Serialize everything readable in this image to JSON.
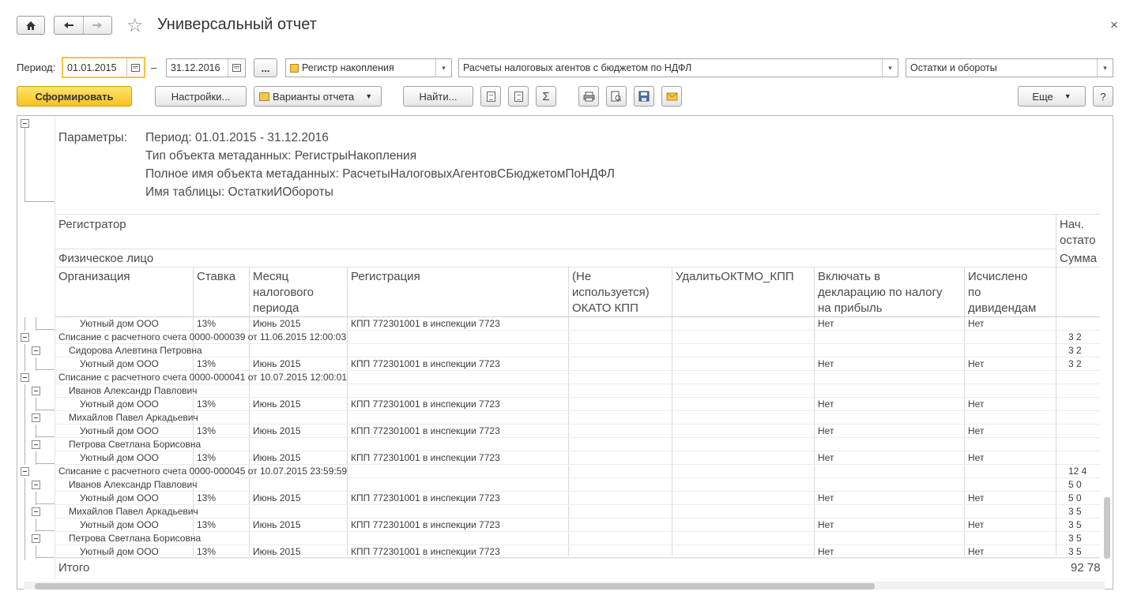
{
  "window": {
    "title": "Универсальный отчет",
    "home_icon": "home-icon",
    "back_icon": "arrow-left-icon",
    "forward_icon": "arrow-right-icon",
    "favorite_icon": "star-icon",
    "close_label": "×"
  },
  "period": {
    "label": "Период:",
    "from": "01.01.2015",
    "dash": "–",
    "to": "31.12.2016",
    "choose_label": "...",
    "source_type": "Регистр накопления",
    "source_object": "Расчеты налоговых агентов с бюджетом по НДФЛ",
    "source_table": "Остатки и обороты"
  },
  "toolbar": {
    "generate": "Сформировать",
    "settings": "Настройки...",
    "variants": "Варианты отчета",
    "find": "Найти...",
    "sum_symbol": "Σ",
    "more": "Еще",
    "help": "?"
  },
  "params": {
    "label": "Параметры:",
    "lines": [
      "Период: 01.01.2015 - 31.12.2016",
      "Тип объекта метаданных: РегистрыНакопления",
      "Полное имя объекта метаданных: РасчетыНалоговыхАгентовСБюджетомПоНДФЛ",
      "Имя таблицы: ОстаткиИОбороты"
    ]
  },
  "headers": {
    "registrar": "Регистратор",
    "person": "Физическое лицо",
    "org": "Организация",
    "rate": "Ставка",
    "month": [
      "Месяц",
      "налогового",
      "периода"
    ],
    "registration": "Регистрация",
    "okato": [
      "(Не",
      "используется)",
      "ОКАТО КПП"
    ],
    "delete_oktmo": "УдалитьОКТМО_КПП",
    "include_decl": [
      "Включать в",
      "декларацию по налогу",
      "на прибыль"
    ],
    "calc_div": [
      "Исчислено",
      "по",
      "дивидендам"
    ],
    "opening": [
      "Нач.",
      "остато"
    ],
    "sum": "Сумма"
  },
  "rows": [
    {
      "kind": "detail",
      "org": "Уютный дом ООО",
      "rate": "13%",
      "month": "Июнь 2015",
      "reg": "КПП 772301001 в инспекции 7723",
      "decl": "Нет",
      "div": "Нет",
      "amount": ""
    },
    {
      "kind": "doc",
      "text": "Списание с расчетного счета 0000-000039 от 11.06.2015 12:00:03",
      "amount": "3 2"
    },
    {
      "kind": "person",
      "text": "Сидорова Алевтина Петровна",
      "amount": "3 2"
    },
    {
      "kind": "detail",
      "org": "Уютный дом ООО",
      "rate": "13%",
      "month": "Июнь 2015",
      "reg": "КПП 772301001 в инспекции 7723",
      "decl": "Нет",
      "div": "Нет",
      "amount": "3 2"
    },
    {
      "kind": "doc",
      "text": "Списание с расчетного счета 0000-000041 от 10.07.2015 12:00:01",
      "amount": ""
    },
    {
      "kind": "person",
      "text": "Иванов Александр Павлович",
      "amount": ""
    },
    {
      "kind": "detail",
      "org": "Уютный дом ООО",
      "rate": "13%",
      "month": "Июнь 2015",
      "reg": "КПП 772301001 в инспекции 7723",
      "decl": "Нет",
      "div": "Нет",
      "amount": ""
    },
    {
      "kind": "person",
      "text": "Михайлов Павел Аркадьевич",
      "amount": ""
    },
    {
      "kind": "detail",
      "org": "Уютный дом ООО",
      "rate": "13%",
      "month": "Июнь 2015",
      "reg": "КПП 772301001 в инспекции 7723",
      "decl": "Нет",
      "div": "Нет",
      "amount": ""
    },
    {
      "kind": "person",
      "text": "Петрова Светлана Борисовна",
      "amount": ""
    },
    {
      "kind": "detail",
      "org": "Уютный дом ООО",
      "rate": "13%",
      "month": "Июнь 2015",
      "reg": "КПП 772301001 в инспекции 7723",
      "decl": "Нет",
      "div": "Нет",
      "amount": ""
    },
    {
      "kind": "doc",
      "text": "Списание с расчетного счета 0000-000045 от 10.07.2015 23:59:59",
      "amount": "12 4"
    },
    {
      "kind": "person",
      "text": "Иванов Александр Павлович",
      "amount": "5 0"
    },
    {
      "kind": "detail",
      "org": "Уютный дом ООО",
      "rate": "13%",
      "month": "Июнь 2015",
      "reg": "КПП 772301001 в инспекции 7723",
      "decl": "Нет",
      "div": "Нет",
      "amount": "5 0"
    },
    {
      "kind": "person",
      "text": "Михайлов Павел Аркадьевич",
      "amount": "3 5"
    },
    {
      "kind": "detail",
      "org": "Уютный дом ООО",
      "rate": "13%",
      "month": "Июнь 2015",
      "reg": "КПП 772301001 в инспекции 7723",
      "decl": "Нет",
      "div": "Нет",
      "amount": "3 5"
    },
    {
      "kind": "person",
      "text": "Петрова Светлана Борисовна",
      "amount": "3 5"
    },
    {
      "kind": "detail",
      "org": "Уютный дом ООО",
      "rate": "13%",
      "month": "Июнь 2015",
      "reg": "КПП 772301001 в инспекции 7723",
      "decl": "Нет",
      "div": "Нет",
      "amount": "3 5"
    }
  ],
  "total": {
    "label": "Итого",
    "amount": "92 78"
  }
}
